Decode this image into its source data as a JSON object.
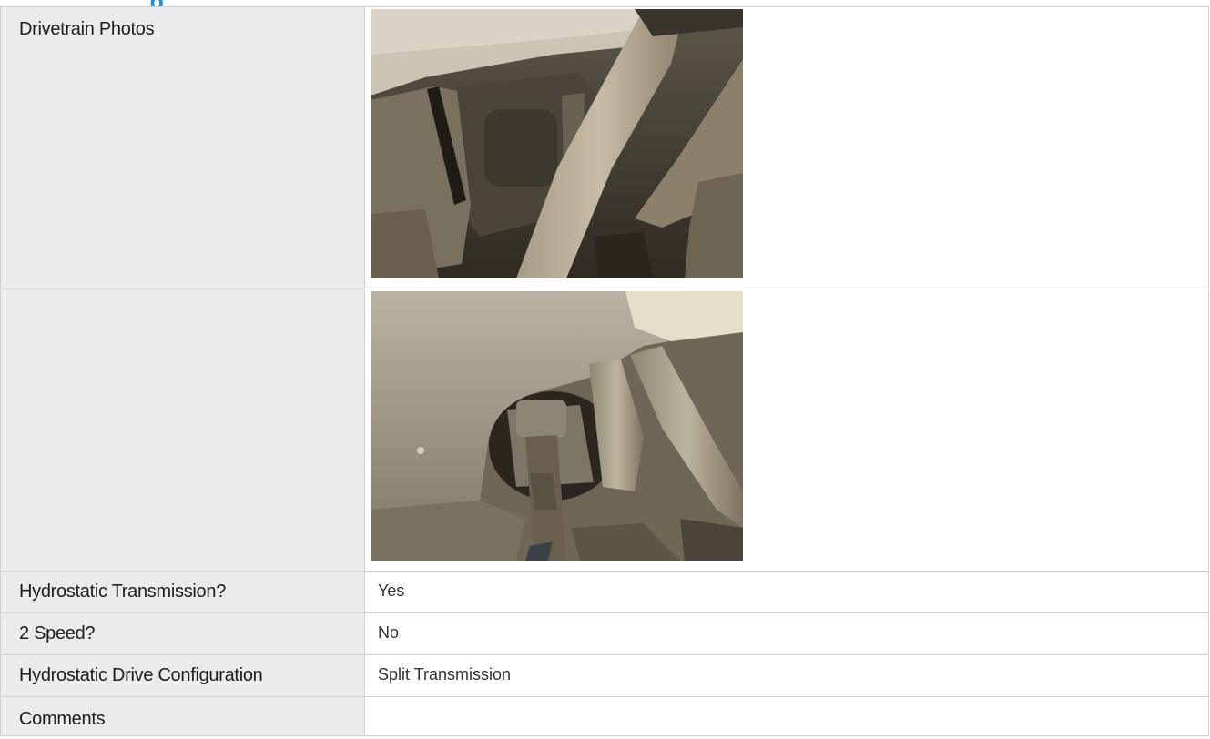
{
  "header": {
    "title_fragment": "p"
  },
  "rows": {
    "drivetrain_photos": {
      "label": "Drivetrain Photos"
    },
    "photo_two": {
      "label": ""
    },
    "hydrostatic_transmission": {
      "label": "Hydrostatic Transmission?",
      "value": "Yes"
    },
    "two_speed": {
      "label": "2 Speed?",
      "value": "No"
    },
    "drive_configuration": {
      "label": "Hydrostatic Drive Configuration",
      "value": "Split Transmission"
    },
    "comments": {
      "label": "Comments",
      "value": ""
    }
  },
  "colors": {
    "label_bg": "#ebebeb",
    "border": "#d0d0d0",
    "accent": "#1a8fd6"
  }
}
